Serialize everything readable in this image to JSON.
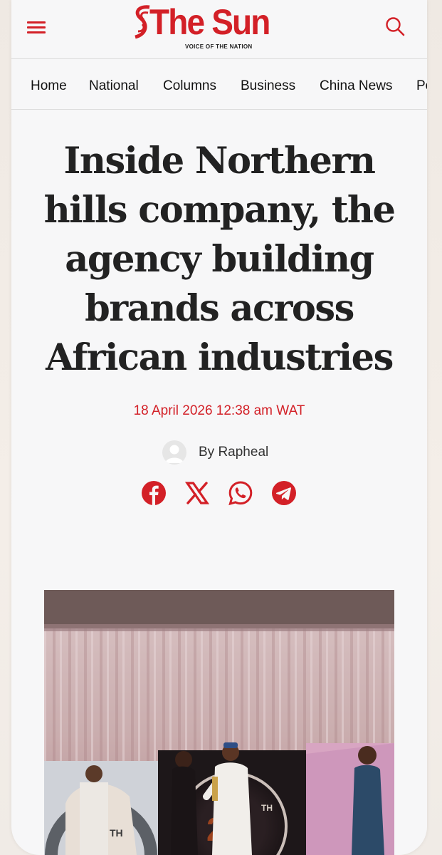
{
  "header": {
    "logo_text": "The Sun",
    "tagline": "VOICE OF THE NATION",
    "menu_icon": "hamburger-menu-icon",
    "search_icon": "search-icon",
    "brand_color": "#d32027"
  },
  "nav": {
    "items": [
      {
        "label": "Home"
      },
      {
        "label": "National"
      },
      {
        "label": "Columns"
      },
      {
        "label": "Business"
      },
      {
        "label": "China News"
      },
      {
        "label": "Po"
      }
    ]
  },
  "article": {
    "title": "Inside Northern hills company, the agency building brands across African industries",
    "date": "18 April 2026 12:38 am WAT",
    "author": "By Rapheal",
    "share": [
      {
        "icon": "facebook-icon"
      },
      {
        "icon": "x-icon"
      },
      {
        "icon": "whatsapp-icon"
      },
      {
        "icon": "telegram-icon"
      }
    ]
  }
}
